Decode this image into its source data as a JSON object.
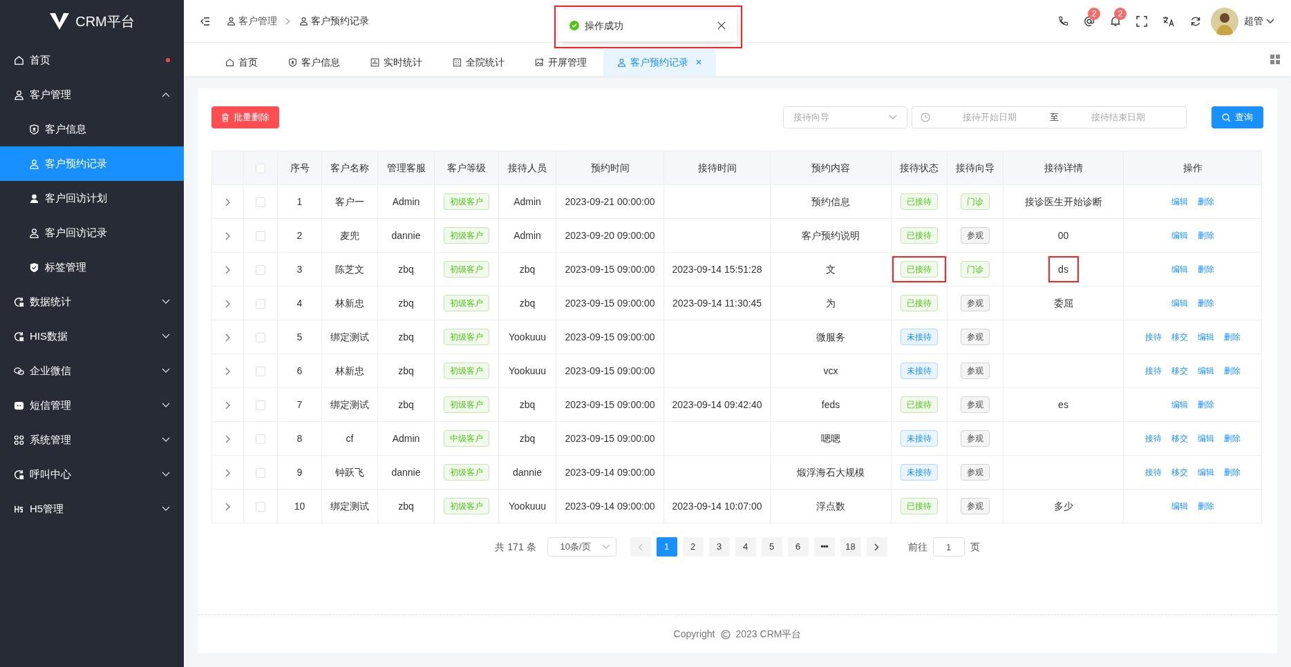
{
  "sidebar": {
    "logo": "CRM平台",
    "items": [
      {
        "label": "首页",
        "dot": true,
        "selected": false
      },
      {
        "label": "客户管理",
        "expanded": true,
        "selected": false,
        "children": [
          {
            "label": "客户信息",
            "selected": false
          },
          {
            "label": "客户预约记录",
            "selected": true
          },
          {
            "label": "客户回访计划",
            "selected": false
          },
          {
            "label": "客户回访记录",
            "selected": false
          },
          {
            "label": "标签管理",
            "selected": false
          }
        ]
      },
      {
        "label": "数据统计",
        "expanded": false,
        "selected": false
      },
      {
        "label": "HIS数据",
        "expanded": false,
        "selected": false
      },
      {
        "label": "企业微信",
        "expanded": false,
        "selected": false
      },
      {
        "label": "短信管理",
        "expanded": false,
        "selected": false
      },
      {
        "label": "系统管理",
        "expanded": false,
        "selected": false
      },
      {
        "label": "呼叫中心",
        "expanded": false,
        "selected": false
      },
      {
        "label": "H5管理",
        "expanded": false,
        "selected": false
      }
    ]
  },
  "breadcrumb": [
    "客户管理",
    "客户预约记录"
  ],
  "header": {
    "mention_badge": "2",
    "bell_badge": "2",
    "user": "超管"
  },
  "toast": {
    "message": "操作成功",
    "annotated": true
  },
  "tabs": [
    {
      "label": "首页",
      "selected": false
    },
    {
      "label": "客户信息",
      "selected": false
    },
    {
      "label": "实时统计",
      "selected": false
    },
    {
      "label": "全院统计",
      "selected": false
    },
    {
      "label": "开屏管理",
      "selected": false
    },
    {
      "label": "客户预约记录",
      "selected": true,
      "closable": true
    }
  ],
  "toolbar": {
    "batch_delete": "批量删除",
    "guide_placeholder": "接待向导",
    "start_placeholder": "接待开始日期",
    "range_separator": "至",
    "end_placeholder": "接待结束日期",
    "query": "查询"
  },
  "table": {
    "columns": [
      "序号",
      "客户名称",
      "管理客服",
      "客户等级",
      "接待人员",
      "预约时间",
      "接待时间",
      "预约内容",
      "接待状态",
      "接待向导",
      "接待详情",
      "操作"
    ],
    "all_checked": false,
    "rows": [
      {
        "expanded": false,
        "checked": false,
        "no": "1",
        "name": "客户一",
        "manager": "Admin",
        "level": "初级客户",
        "staff": "Admin",
        "booked": "2023-09-21 00:00:00",
        "received": "",
        "content": "预约信息",
        "status": {
          "text": "已接待",
          "kind": "success"
        },
        "guide": {
          "text": "门诊",
          "kind": "success"
        },
        "detail": "接诊医生开始诊断",
        "actions": [
          "编辑",
          "删除"
        ]
      },
      {
        "expanded": false,
        "checked": false,
        "no": "2",
        "name": "麦兜",
        "manager": "dannie",
        "level": "初级客户",
        "staff": "Admin",
        "booked": "2023-09-20 09:00:00",
        "received": "",
        "content": "客户预约说明",
        "status": {
          "text": "已接待",
          "kind": "success"
        },
        "guide": {
          "text": "参观",
          "kind": "neutral"
        },
        "detail": "00",
        "actions": [
          "编辑",
          "删除"
        ]
      },
      {
        "expanded": false,
        "checked": false,
        "no": "3",
        "name": "陈芝文",
        "manager": "zbq",
        "level": "初级客户",
        "staff": "zbq",
        "booked": "2023-09-15 09:00:00",
        "received": "2023-09-14 15:51:28",
        "content": "文",
        "status": {
          "text": "已接待",
          "kind": "success",
          "annotated": true
        },
        "guide": {
          "text": "门诊",
          "kind": "success"
        },
        "detail": "ds",
        "detail_annotated": true,
        "actions": [
          "编辑",
          "删除"
        ]
      },
      {
        "expanded": false,
        "checked": false,
        "no": "4",
        "name": "林新忠",
        "manager": "zbq",
        "level": "初级客户",
        "staff": "zbq",
        "booked": "2023-09-15 09:00:00",
        "received": "2023-09-14 11:30:45",
        "content": "为",
        "status": {
          "text": "已接待",
          "kind": "success"
        },
        "guide": {
          "text": "参观",
          "kind": "neutral"
        },
        "detail": "委屈",
        "actions": [
          "编辑",
          "删除"
        ]
      },
      {
        "expanded": false,
        "checked": false,
        "no": "5",
        "name": "绑定测试",
        "manager": "zbq",
        "level": "初级客户",
        "staff": "Yookuuu",
        "booked": "2023-09-15 09:00:00",
        "received": "",
        "content": "微服务",
        "status": {
          "text": "未接待",
          "kind": "info"
        },
        "guide": {
          "text": "参观",
          "kind": "neutral"
        },
        "detail": "",
        "actions": [
          "接待",
          "移交",
          "编辑",
          "删除"
        ]
      },
      {
        "expanded": false,
        "checked": false,
        "no": "6",
        "name": "林新忠",
        "manager": "zbq",
        "level": "初级客户",
        "staff": "Yookuuu",
        "booked": "2023-09-15 09:00:00",
        "received": "",
        "content": "vcx",
        "status": {
          "text": "未接待",
          "kind": "info"
        },
        "guide": {
          "text": "参观",
          "kind": "neutral"
        },
        "detail": "",
        "actions": [
          "接待",
          "移交",
          "编辑",
          "删除"
        ]
      },
      {
        "expanded": false,
        "checked": false,
        "no": "7",
        "name": "绑定测试",
        "manager": "zbq",
        "level": "初级客户",
        "staff": "zbq",
        "booked": "2023-09-15 09:00:00",
        "received": "2023-09-14 09:42:40",
        "content": "feds",
        "status": {
          "text": "已接待",
          "kind": "success"
        },
        "guide": {
          "text": "参观",
          "kind": "neutral"
        },
        "detail": "es",
        "actions": [
          "编辑",
          "删除"
        ]
      },
      {
        "expanded": false,
        "checked": false,
        "no": "8",
        "name": "cf",
        "manager": "Admin",
        "level": "中级客户",
        "staff": "zbq",
        "booked": "2023-09-15 09:00:00",
        "received": "",
        "content": "嗯嗯",
        "status": {
          "text": "未接待",
          "kind": "info"
        },
        "guide": {
          "text": "参观",
          "kind": "neutral"
        },
        "detail": "",
        "actions": [
          "接待",
          "移交",
          "编辑",
          "删除"
        ]
      },
      {
        "expanded": false,
        "checked": false,
        "no": "9",
        "name": "钟跃飞",
        "manager": "dannie",
        "level": "初级客户",
        "staff": "dannie",
        "booked": "2023-09-14 09:00:00",
        "received": "",
        "content": "煅浮海石大规模",
        "status": {
          "text": "未接待",
          "kind": "info"
        },
        "guide": {
          "text": "参观",
          "kind": "neutral"
        },
        "detail": "",
        "actions": [
          "接待",
          "移交",
          "编辑",
          "删除"
        ]
      },
      {
        "expanded": false,
        "checked": false,
        "no": "10",
        "name": "绑定测试",
        "manager": "zbq",
        "level": "初级客户",
        "staff": "Yookuuu",
        "booked": "2023-09-14 09:00:00",
        "received": "2023-09-14 10:07:00",
        "content": "浮点数",
        "status": {
          "text": "已接待",
          "kind": "success"
        },
        "guide": {
          "text": "参观",
          "kind": "neutral"
        },
        "detail": "多少",
        "actions": [
          "编辑",
          "删除"
        ]
      }
    ]
  },
  "pagination": {
    "total": "共 171 条",
    "page_size": "10条/页",
    "prev_disabled": true,
    "next_disabled": false,
    "pages": [
      {
        "label": "1",
        "kind": "page",
        "selected": true
      },
      {
        "label": "2",
        "kind": "page",
        "selected": false
      },
      {
        "label": "3",
        "kind": "page",
        "selected": false
      },
      {
        "label": "4",
        "kind": "page",
        "selected": false
      },
      {
        "label": "5",
        "kind": "page",
        "selected": false
      },
      {
        "label": "6",
        "kind": "page",
        "selected": false
      },
      {
        "label": "•••",
        "kind": "more",
        "selected": false
      },
      {
        "label": "18",
        "kind": "page",
        "selected": false
      }
    ],
    "goto_label": "前往",
    "goto_value": "1",
    "goto_suffix": "页"
  },
  "footer": {
    "copyright": "Copyright",
    "text": "2023 CRM平台"
  }
}
